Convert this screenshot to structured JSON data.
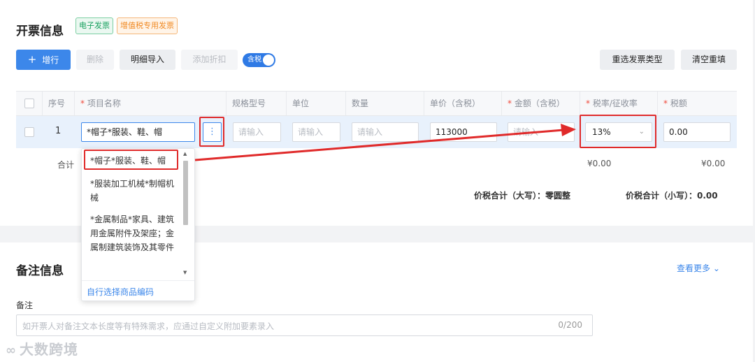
{
  "invoice_section": {
    "title": "开票信息",
    "tags": {
      "electronic": "电子发票",
      "vat_special": "增值税专用发票"
    }
  },
  "toolbar": {
    "add_label": "增行",
    "delete_label": "删除",
    "import_label": "明细导入",
    "discount_label": "添加折扣",
    "tax_toggle_label": "含税",
    "reselect_label": "重选发票类型",
    "clear_label": "清空重填"
  },
  "table": {
    "headers": {
      "seq": "序号",
      "item_name": "项目名称",
      "spec": "规格型号",
      "unit": "单位",
      "quantity": "数量",
      "unit_price": "单价（含税）",
      "amount": "金额（含税）",
      "tax_rate": "税率/征收率",
      "tax": "税额"
    },
    "required_mark": "*",
    "row": {
      "seq": "1",
      "item_name": "*帽子*服装、鞋、帽",
      "spec_placeholder": "请输入",
      "unit_placeholder": "请输入",
      "quantity_placeholder": "请输入",
      "unit_price": "113000",
      "amount_placeholder": "请输入",
      "tax_rate": "13%",
      "tax": "0.00"
    },
    "summary": {
      "label": "合计",
      "amount_total": "¥0.00",
      "tax_total": "¥0.00",
      "total_upper_label": "价税合计（大写）：",
      "total_upper_value": "零圆整",
      "total_lower_label": "价税合计（小写）：",
      "total_lower_value": "0.00"
    }
  },
  "dropdown": {
    "items": [
      "*帽子*服装、鞋、帽",
      "*服装加工机械*制帽机械",
      "*金属制品*家具、建筑用金属附件及架座；金属制建筑装饰及其零件"
    ],
    "footer": "自行选择商品编码"
  },
  "remarks_section": {
    "title": "备注信息",
    "view_more": "查看更多",
    "field_label": "备注",
    "placeholder": "如开票人对备注文本长度等有特殊需求，应通过自定义附加要素录入",
    "counter": "0/200"
  },
  "watermark": "大数跨境",
  "colors": {
    "primary": "#3c87ea",
    "annotation_red": "#e02a2a",
    "required": "#f04b3c"
  }
}
